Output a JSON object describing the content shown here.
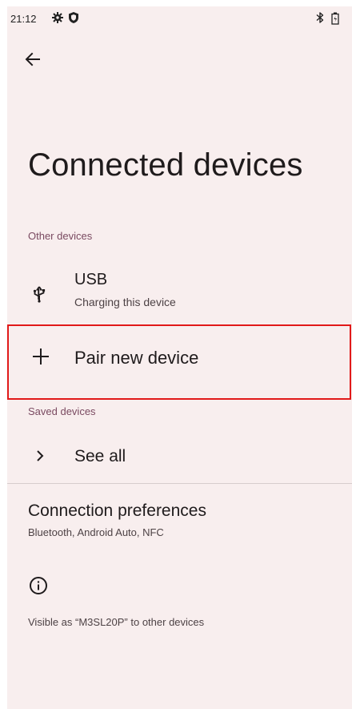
{
  "status_bar": {
    "time": "21:12",
    "icons": [
      "gear-icon",
      "shield-icon",
      "bluetooth-icon",
      "battery-icon"
    ]
  },
  "header": {
    "back_icon": "arrow-left-icon",
    "title": "Connected devices"
  },
  "sections": {
    "other_devices": {
      "header": "Other devices",
      "usb": {
        "title": "USB",
        "subtitle": "Charging this device",
        "icon": "usb-icon"
      },
      "pair": {
        "label": "Pair new device",
        "icon": "plus-icon"
      }
    },
    "saved_devices": {
      "header": "Saved devices",
      "see_all": {
        "label": "See all",
        "icon": "chevron-right-icon"
      }
    },
    "connection_preferences": {
      "title": "Connection preferences",
      "subtitle": "Bluetooth, Android Auto, NFC"
    },
    "footer": {
      "info_icon": "info-icon",
      "visible_as": "Visible as “M3SL20P” to other devices"
    }
  },
  "colors": {
    "background": "#f8eeee",
    "section_header": "#7a4a61",
    "highlight_border": "#e11919"
  }
}
